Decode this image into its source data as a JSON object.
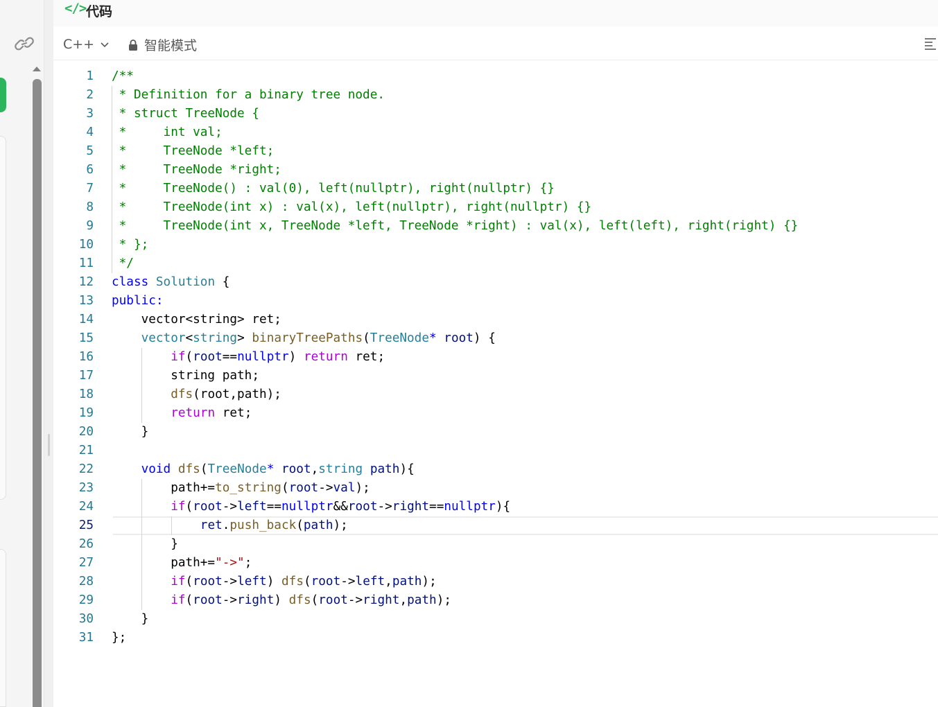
{
  "panel": {
    "title": "代码",
    "code_icon": "</>",
    "language": "C++",
    "mode_label": "智能模式"
  },
  "editor": {
    "current_line": 25,
    "lines": [
      [
        [
          "c",
          "/**"
        ]
      ],
      [
        [
          "c",
          " * Definition for a binary tree node."
        ]
      ],
      [
        [
          "c",
          " * struct TreeNode {"
        ]
      ],
      [
        [
          "c",
          " *     int val;"
        ]
      ],
      [
        [
          "c",
          " *     TreeNode *left;"
        ]
      ],
      [
        [
          "c",
          " *     TreeNode *right;"
        ]
      ],
      [
        [
          "c",
          " *     TreeNode() : val(0), left(nullptr), right(nullptr) {}"
        ]
      ],
      [
        [
          "c",
          " *     TreeNode(int x) : val(x), left(nullptr), right(nullptr) {}"
        ]
      ],
      [
        [
          "c",
          " *     TreeNode(int x, TreeNode *left, TreeNode *right) : val(x), left(left), right(right) {}"
        ]
      ],
      [
        [
          "c",
          " * };"
        ]
      ],
      [
        [
          "c",
          " */"
        ]
      ],
      [
        [
          "k",
          "class"
        ],
        [
          "p",
          " "
        ],
        [
          "ty",
          "Solution"
        ],
        [
          "p",
          " {"
        ]
      ],
      [
        [
          "k",
          "public:"
        ]
      ],
      [
        [
          "p",
          "    vector<string> ret;"
        ]
      ],
      [
        [
          "p",
          "    "
        ],
        [
          "ty",
          "vector"
        ],
        [
          "p",
          "<"
        ],
        [
          "ty",
          "string"
        ],
        [
          "p",
          "> "
        ],
        [
          "f",
          "binaryTreePaths"
        ],
        [
          "p",
          "("
        ],
        [
          "ty",
          "TreeNode"
        ],
        [
          "k",
          "*"
        ],
        [
          "p",
          " "
        ],
        [
          "v",
          "root"
        ],
        [
          "p",
          ") {"
        ]
      ],
      [
        [
          "p",
          "        "
        ],
        [
          "ctl",
          "if"
        ],
        [
          "p",
          "("
        ],
        [
          "v",
          "root"
        ],
        [
          "p",
          "=="
        ],
        [
          "k",
          "nullptr"
        ],
        [
          "p",
          ") "
        ],
        [
          "ctl",
          "return"
        ],
        [
          "p",
          " ret;"
        ]
      ],
      [
        [
          "p",
          "        string path;"
        ]
      ],
      [
        [
          "p",
          "        "
        ],
        [
          "f",
          "dfs"
        ],
        [
          "p",
          "(root,path);"
        ]
      ],
      [
        [
          "p",
          "        "
        ],
        [
          "ctl",
          "return"
        ],
        [
          "p",
          " ret;"
        ]
      ],
      [
        [
          "p",
          "    }"
        ]
      ],
      [
        [
          "p",
          ""
        ]
      ],
      [
        [
          "p",
          "    "
        ],
        [
          "k",
          "void"
        ],
        [
          "p",
          " "
        ],
        [
          "f",
          "dfs"
        ],
        [
          "p",
          "("
        ],
        [
          "ty",
          "TreeNode"
        ],
        [
          "k",
          "*"
        ],
        [
          "p",
          " "
        ],
        [
          "v",
          "root"
        ],
        [
          "p",
          ","
        ],
        [
          "ty",
          "string"
        ],
        [
          "p",
          " "
        ],
        [
          "v",
          "path"
        ],
        [
          "p",
          "){"
        ]
      ],
      [
        [
          "p",
          "        path+="
        ],
        [
          "f",
          "to_string"
        ],
        [
          "p",
          "("
        ],
        [
          "v",
          "root"
        ],
        [
          "p",
          "->"
        ],
        [
          "v",
          "val"
        ],
        [
          "p",
          ");"
        ]
      ],
      [
        [
          "p",
          "        "
        ],
        [
          "ctl",
          "if"
        ],
        [
          "p",
          "("
        ],
        [
          "v",
          "root"
        ],
        [
          "p",
          "->"
        ],
        [
          "v",
          "left"
        ],
        [
          "p",
          "=="
        ],
        [
          "k",
          "nullptr"
        ],
        [
          "p",
          "&&"
        ],
        [
          "v",
          "root"
        ],
        [
          "p",
          "->"
        ],
        [
          "v",
          "right"
        ],
        [
          "p",
          "=="
        ],
        [
          "k",
          "nullptr"
        ],
        [
          "p",
          "){"
        ]
      ],
      [
        [
          "p",
          "            "
        ],
        [
          "v",
          "ret"
        ],
        [
          "p",
          "."
        ],
        [
          "f",
          "push_back"
        ],
        [
          "p",
          "("
        ],
        [
          "v",
          "path"
        ],
        [
          "p",
          ");"
        ]
      ],
      [
        [
          "p",
          "        }"
        ]
      ],
      [
        [
          "p",
          "        path+="
        ],
        [
          "s",
          "\"->\""
        ],
        [
          "p",
          ";"
        ]
      ],
      [
        [
          "p",
          "        "
        ],
        [
          "ctl",
          "if"
        ],
        [
          "p",
          "("
        ],
        [
          "v",
          "root"
        ],
        [
          "p",
          "->"
        ],
        [
          "v",
          "left"
        ],
        [
          "p",
          ") "
        ],
        [
          "f",
          "dfs"
        ],
        [
          "p",
          "("
        ],
        [
          "v",
          "root"
        ],
        [
          "p",
          "->"
        ],
        [
          "v",
          "left"
        ],
        [
          "p",
          ","
        ],
        [
          "v",
          "path"
        ],
        [
          "p",
          ");"
        ]
      ],
      [
        [
          "p",
          "        "
        ],
        [
          "ctl",
          "if"
        ],
        [
          "p",
          "("
        ],
        [
          "v",
          "root"
        ],
        [
          "p",
          "->"
        ],
        [
          "v",
          "right"
        ],
        [
          "p",
          ") "
        ],
        [
          "f",
          "dfs"
        ],
        [
          "p",
          "("
        ],
        [
          "v",
          "root"
        ],
        [
          "p",
          "->"
        ],
        [
          "v",
          "right"
        ],
        [
          "p",
          ","
        ],
        [
          "v",
          "path"
        ],
        [
          "p",
          ");"
        ]
      ],
      [
        [
          "p",
          "    }"
        ]
      ],
      [
        [
          "p",
          "};"
        ]
      ]
    ]
  }
}
